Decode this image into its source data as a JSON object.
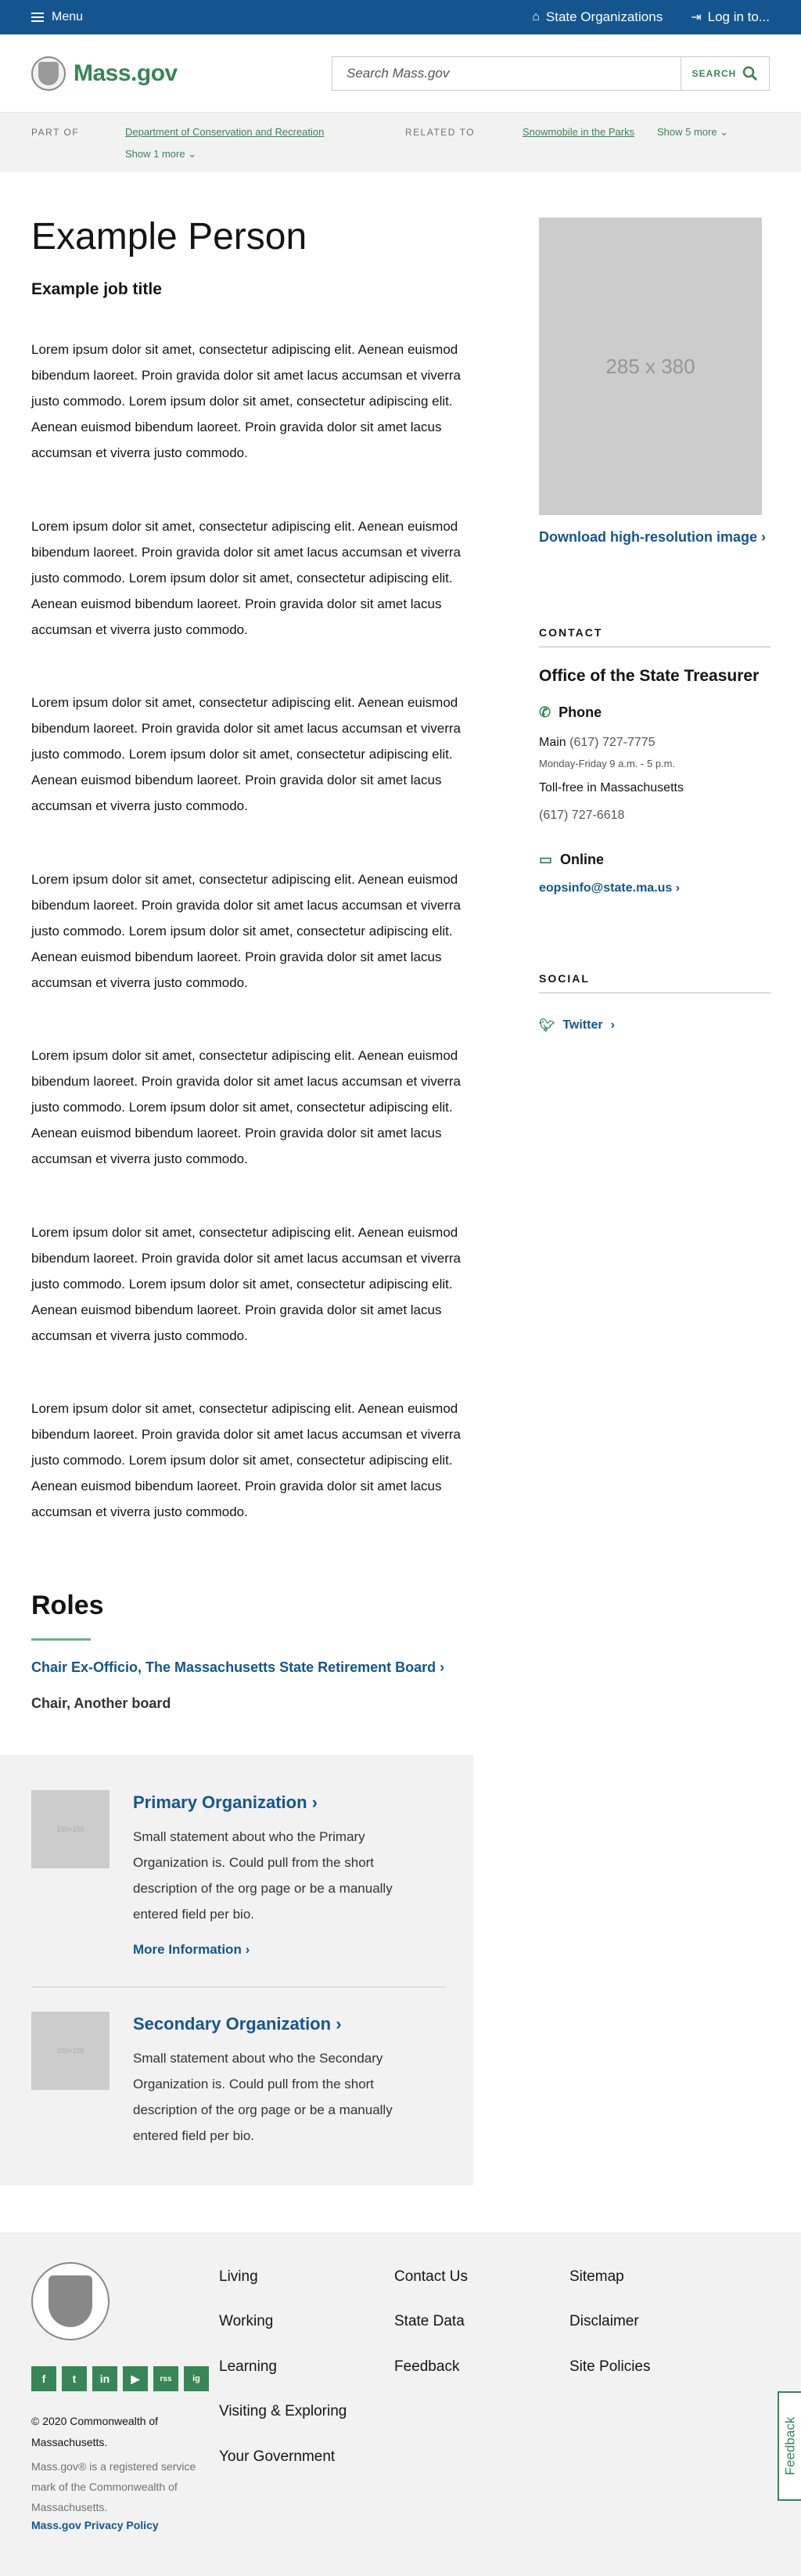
{
  "utility": {
    "menu": "Menu",
    "state_orgs": "State Organizations",
    "login": "Log in to..."
  },
  "header": {
    "logo": "Mass.gov",
    "search_placeholder": "Search Mass.gov",
    "search_button": "SEARCH"
  },
  "relationships": {
    "part_of_label": "PART OF",
    "part_of_link": "Department of Conservation and Recreation",
    "part_of_more": "Show 1 more",
    "related_label": "RELATED TO",
    "related_link": "Snowmobile in the Parks",
    "related_more": "Show 5 more"
  },
  "person": {
    "name": "Example Person",
    "job_title": "Example job title",
    "paragraphs": [
      "Lorem ipsum dolor sit amet, consectetur adipiscing elit. Aenean euismod bibendum laoreet. Proin gravida dolor sit amet lacus accumsan et viverra justo commodo. Lorem ipsum dolor sit amet, consectetur adipiscing elit. Aenean euismod bibendum laoreet. Proin gravida dolor sit amet lacus accumsan et viverra justo commodo.",
      "Lorem ipsum dolor sit amet, consectetur adipiscing elit. Aenean euismod bibendum laoreet. Proin gravida dolor sit amet lacus accumsan et viverra justo commodo. Lorem ipsum dolor sit amet, consectetur adipiscing elit. Aenean euismod bibendum laoreet. Proin gravida dolor sit amet lacus accumsan et viverra justo commodo.",
      "Lorem ipsum dolor sit amet, consectetur adipiscing elit. Aenean euismod bibendum laoreet. Proin gravida dolor sit amet lacus accumsan et viverra justo commodo. Lorem ipsum dolor sit amet, consectetur adipiscing elit. Aenean euismod bibendum laoreet. Proin gravida dolor sit amet lacus accumsan et viverra justo commodo.",
      "Lorem ipsum dolor sit amet, consectetur adipiscing elit. Aenean euismod bibendum laoreet. Proin gravida dolor sit amet lacus accumsan et viverra justo commodo. Lorem ipsum dolor sit amet, consectetur adipiscing elit. Aenean euismod bibendum laoreet. Proin gravida dolor sit amet lacus accumsan et viverra justo commodo.",
      "Lorem ipsum dolor sit amet, consectetur adipiscing elit. Aenean euismod bibendum laoreet. Proin gravida dolor sit amet lacus accumsan et viverra justo commodo. Lorem ipsum dolor sit amet, consectetur adipiscing elit. Aenean euismod bibendum laoreet. Proin gravida dolor sit amet lacus accumsan et viverra justo commodo.",
      "Lorem ipsum dolor sit amet, consectetur adipiscing elit. Aenean euismod bibendum laoreet. Proin gravida dolor sit amet lacus accumsan et viverra justo commodo. Lorem ipsum dolor sit amet, consectetur adipiscing elit. Aenean euismod bibendum laoreet. Proin gravida dolor sit amet lacus accumsan et viverra justo commodo.",
      "Lorem ipsum dolor sit amet, consectetur adipiscing elit. Aenean euismod bibendum laoreet. Proin gravida dolor sit amet lacus accumsan et viverra justo commodo. Lorem ipsum dolor sit amet, consectetur adipiscing elit. Aenean euismod bibendum laoreet. Proin gravida dolor sit amet lacus accumsan et viverra justo commodo."
    ]
  },
  "sidebar": {
    "image_placeholder": "285 x 380",
    "download": "Download high-resolution image",
    "contact_heading": "CONTACT",
    "org_name": "Office of the State Treasurer",
    "phone_heading": "Phone",
    "main_label": "Main",
    "main_number": "(617) 727-7775",
    "hours": "Monday-Friday 9 a.m. - 5 p.m.",
    "tollfree_label": "Toll-free in Massachusetts",
    "tollfree_number": "(617) 727-6618",
    "online_heading": "Online",
    "email": "eopsinfo@state.ma.us",
    "social_heading": "SOCIAL",
    "twitter": "Twitter"
  },
  "roles": {
    "title": "Roles",
    "link": "Chair Ex-Officio, The Massachusetts State Retirement Board",
    "text": "Chair, Another board"
  },
  "organizations": [
    {
      "thumb": "100×100",
      "title": "Primary Organization",
      "description": "Small statement about who the Primary Organization is. Could pull from the short description of the org page or be a manually entered field per bio.",
      "more": "More Information"
    },
    {
      "thumb": "100×100",
      "title": "Secondary Organization",
      "description": "Small statement about who the Secondary Organization is. Could pull from the short description of the org page or be a manually entered field per bio."
    }
  ],
  "footer": {
    "copyright": "© 2020 Commonwealth of Massachusetts.",
    "trademark": "Mass.gov® is a registered service mark of the Commonwealth of Massachusetts.",
    "privacy": "Mass.gov Privacy Policy",
    "col1": [
      "Living",
      "Working",
      "Learning",
      "Visiting & Exploring",
      "Your Government"
    ],
    "col2": [
      "Contact Us",
      "State Data",
      "Feedback"
    ],
    "col3": [
      "Sitemap",
      "Disclaimer",
      "Site Policies"
    ],
    "social": [
      "f",
      "t",
      "in",
      "▶",
      "rss",
      "ig"
    ],
    "feedback_tab": "Feedback"
  },
  "colors": {
    "brand_blue": "#14558f",
    "brand_green": "#388557",
    "light_gray": "#f2f2f2"
  }
}
